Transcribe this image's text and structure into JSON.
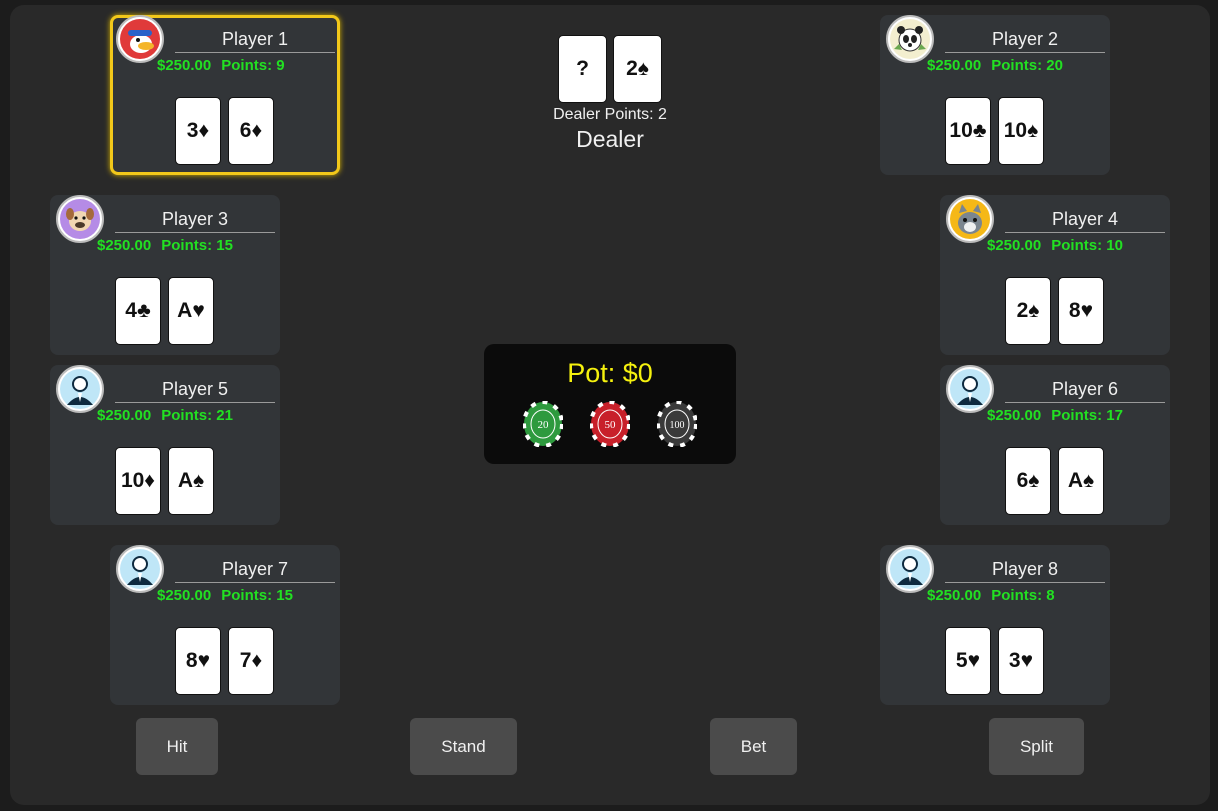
{
  "players": [
    {
      "name": "Player 1",
      "money": "$250.00",
      "points": "Points: 9",
      "cards": [
        "3♦",
        "6♦"
      ],
      "avatar": "duck-avatar-icon",
      "active": true
    },
    {
      "name": "Player 2",
      "money": "$250.00",
      "points": "Points: 20",
      "cards": [
        "10♣",
        "10♠"
      ],
      "avatar": "panda-avatar-icon"
    },
    {
      "name": "Player 3",
      "money": "$250.00",
      "points": "Points: 15",
      "cards": [
        "4♣",
        "A♥"
      ],
      "avatar": "dog-avatar-icon"
    },
    {
      "name": "Player 4",
      "money": "$250.00",
      "points": "Points: 10",
      "cards": [
        "2♠",
        "8♥"
      ],
      "avatar": "cat-avatar-icon"
    },
    {
      "name": "Player 5",
      "money": "$250.00",
      "points": "Points: 21",
      "cards": [
        "10♦",
        "A♠"
      ],
      "avatar": "businessman-avatar-icon"
    },
    {
      "name": "Player 6",
      "money": "$250.00",
      "points": "Points: 17",
      "cards": [
        "6♠",
        "A♠"
      ],
      "avatar": "businessman-avatar-icon"
    },
    {
      "name": "Player 7",
      "money": "$250.00",
      "points": "Points: 15",
      "cards": [
        "8♥",
        "7♦"
      ],
      "avatar": "businessman-avatar-icon"
    },
    {
      "name": "Player 8",
      "money": "$250.00",
      "points": "Points: 8",
      "cards": [
        "5♥",
        "3♥"
      ],
      "avatar": "businessman-avatar-icon"
    }
  ],
  "dealer": {
    "cards": [
      "?",
      "2♠"
    ],
    "points_label": "Dealer Points: 2",
    "name": "Dealer"
  },
  "pot": {
    "label": "Pot: $0",
    "chips": [
      {
        "value": "20",
        "color": "#2e9a3e"
      },
      {
        "value": "50",
        "color": "#c8202a"
      },
      {
        "value": "100",
        "color": "#3a3a3a"
      }
    ]
  },
  "buttons": {
    "hit": "Hit",
    "stand": "Stand",
    "bet": "Bet",
    "split": "Split"
  }
}
